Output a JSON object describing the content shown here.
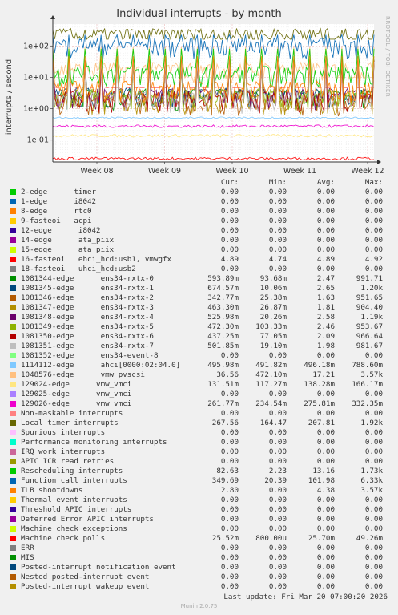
{
  "chart_data": {
    "type": "line",
    "title": "Individual interrupts - by month",
    "ylabel": "interrupts / second",
    "yscale": "log",
    "ylim": [
      0.02,
      500
    ],
    "y_ticks": [
      "1e-01",
      "1e+00",
      "1e+01",
      "1e+02"
    ],
    "x_ticks": [
      "Week 08",
      "Week 09",
      "Week 10",
      "Week 11",
      "Week 12"
    ],
    "grid": true,
    "legend_columns": [
      "Cur:",
      "Min:",
      "Avg:",
      "Max:"
    ],
    "series": [
      {
        "name": "2-edge      timer",
        "color": "#00cc00",
        "stats": [
          "0.00",
          "0.00",
          "0.00",
          "0.00"
        ]
      },
      {
        "name": "1-edge      i8042",
        "color": "#0066b3",
        "stats": [
          "0.00",
          "0.00",
          "0.00",
          "0.00"
        ]
      },
      {
        "name": "8-edge      rtc0",
        "color": "#ff8000",
        "stats": [
          "0.00",
          "0.00",
          "0.00",
          "0.00"
        ]
      },
      {
        "name": "9-fasteoi   acpi",
        "color": "#ffcc00",
        "stats": [
          "0.00",
          "0.00",
          "0.00",
          "0.00"
        ]
      },
      {
        "name": "12-edge      i8042",
        "color": "#330099",
        "stats": [
          "0.00",
          "0.00",
          "0.00",
          "0.00"
        ]
      },
      {
        "name": "14-edge      ata_piix",
        "color": "#990099",
        "stats": [
          "0.00",
          "0.00",
          "0.00",
          "0.00"
        ]
      },
      {
        "name": "15-edge      ata_piix",
        "color": "#ccff00",
        "stats": [
          "0.00",
          "0.00",
          "0.00",
          "0.00"
        ]
      },
      {
        "name": "16-fasteoi   ehci_hcd:usb1, vmwgfx",
        "color": "#ff0000",
        "stats": [
          "4.89",
          "4.74",
          "4.89",
          "4.92"
        ]
      },
      {
        "name": "18-fasteoi   uhci_hcd:usb2",
        "color": "#808080",
        "stats": [
          "0.00",
          "0.00",
          "0.00",
          "0.00"
        ]
      },
      {
        "name": "1081344-edge      ens34-rxtx-0",
        "color": "#008f00",
        "stats": [
          "593.89m",
          "93.68m",
          "2.47",
          "991.71"
        ]
      },
      {
        "name": "1081345-edge      ens34-rxtx-1",
        "color": "#00487d",
        "stats": [
          "674.57m",
          "10.06m",
          "2.65",
          "1.20k"
        ]
      },
      {
        "name": "1081346-edge      ens34-rxtx-2",
        "color": "#b35a00",
        "stats": [
          "342.77m",
          "25.38m",
          "1.63",
          "951.65"
        ]
      },
      {
        "name": "1081347-edge      ens34-rxtx-3",
        "color": "#b38f00",
        "stats": [
          "463.30m",
          "26.87m",
          "1.81",
          "904.40"
        ]
      },
      {
        "name": "1081348-edge      ens34-rxtx-4",
        "color": "#6b006b",
        "stats": [
          "525.98m",
          "20.26m",
          "2.58",
          "1.19k"
        ]
      },
      {
        "name": "1081349-edge      ens34-rxtx-5",
        "color": "#8fb300",
        "stats": [
          "472.30m",
          "103.33m",
          "2.46",
          "953.67"
        ]
      },
      {
        "name": "1081350-edge      ens34-rxtx-6",
        "color": "#b30000",
        "stats": [
          "437.25m",
          "77.05m",
          "2.09",
          "966.64"
        ]
      },
      {
        "name": "1081351-edge      ens34-rxtx-7",
        "color": "#bebebe",
        "stats": [
          "501.85m",
          "19.10m",
          "1.98",
          "981.67"
        ]
      },
      {
        "name": "1081352-edge      ens34-event-8",
        "color": "#80ff80",
        "stats": [
          "0.00",
          "0.00",
          "0.00",
          "0.00"
        ]
      },
      {
        "name": "1114112-edge      ahci[0000:02:04.0]",
        "color": "#80c9ff",
        "stats": [
          "495.98m",
          "491.82m",
          "496.18m",
          "788.60m"
        ]
      },
      {
        "name": "1048576-edge      vmw_pvscsi",
        "color": "#ffc080",
        "stats": [
          "36.56",
          "472.10m",
          "17.21",
          "3.57k"
        ]
      },
      {
        "name": "129024-edge      vmw_vmci",
        "color": "#ffe680",
        "stats": [
          "131.51m",
          "117.27m",
          "138.28m",
          "166.17m"
        ]
      },
      {
        "name": "129025-edge      vmw_vmci",
        "color": "#aa80ff",
        "stats": [
          "0.00",
          "0.00",
          "0.00",
          "0.00"
        ]
      },
      {
        "name": "129026-edge      vmw_vmci",
        "color": "#ee00cc",
        "stats": [
          "261.77m",
          "234.54m",
          "275.81m",
          "332.35m"
        ]
      },
      {
        "name": "Non-maskable interrupts",
        "color": "#ff8080",
        "stats": [
          "0.00",
          "0.00",
          "0.00",
          "0.00"
        ]
      },
      {
        "name": "Local timer interrupts",
        "color": "#666600",
        "stats": [
          "267.56",
          "164.47",
          "207.81",
          "1.92k"
        ]
      },
      {
        "name": "Spurious interrupts",
        "color": "#ffbfff",
        "stats": [
          "0.00",
          "0.00",
          "0.00",
          "0.00"
        ]
      },
      {
        "name": "Performance monitoring interrupts",
        "color": "#00ffcc",
        "stats": [
          "0.00",
          "0.00",
          "0.00",
          "0.00"
        ]
      },
      {
        "name": "IRQ work interrupts",
        "color": "#cc6699",
        "stats": [
          "0.00",
          "0.00",
          "0.00",
          "0.00"
        ]
      },
      {
        "name": "APIC ICR read retries",
        "color": "#999900",
        "stats": [
          "0.00",
          "0.00",
          "0.00",
          "0.00"
        ]
      },
      {
        "name": "Rescheduling interrupts",
        "color": "#00cc00",
        "stats": [
          "82.63",
          "2.23",
          "13.16",
          "1.73k"
        ]
      },
      {
        "name": "Function call interrupts",
        "color": "#0066b3",
        "stats": [
          "349.69",
          "20.39",
          "101.98",
          "6.33k"
        ]
      },
      {
        "name": "TLB shootdowns",
        "color": "#ff8000",
        "stats": [
          "2.80",
          "0.00",
          "4.38",
          "3.57k"
        ]
      },
      {
        "name": "Thermal event interrupts",
        "color": "#ffcc00",
        "stats": [
          "0.00",
          "0.00",
          "0.00",
          "0.00"
        ]
      },
      {
        "name": "Threshold APIC interrupts",
        "color": "#330099",
        "stats": [
          "0.00",
          "0.00",
          "0.00",
          "0.00"
        ]
      },
      {
        "name": "Deferred Error APIC interrupts",
        "color": "#990099",
        "stats": [
          "0.00",
          "0.00",
          "0.00",
          "0.00"
        ]
      },
      {
        "name": "Machine check exceptions",
        "color": "#ccff00",
        "stats": [
          "0.00",
          "0.00",
          "0.00",
          "0.00"
        ]
      },
      {
        "name": "Machine check polls",
        "color": "#ff0000",
        "stats": [
          "25.52m",
          "800.00u",
          "25.70m",
          "49.26m"
        ]
      },
      {
        "name": "ERR",
        "color": "#808080",
        "stats": [
          "0.00",
          "0.00",
          "0.00",
          "0.00"
        ]
      },
      {
        "name": "MIS",
        "color": "#008f00",
        "stats": [
          "0.00",
          "0.00",
          "0.00",
          "0.00"
        ]
      },
      {
        "name": "Posted-interrupt notification event",
        "color": "#00487d",
        "stats": [
          "0.00",
          "0.00",
          "0.00",
          "0.00"
        ]
      },
      {
        "name": "Nested posted-interrupt event",
        "color": "#b35a00",
        "stats": [
          "0.00",
          "0.00",
          "0.00",
          "0.00"
        ]
      },
      {
        "name": "Posted-interrupt wakeup event",
        "color": "#b38f00",
        "stats": [
          "0.00",
          "0.00",
          "0.00",
          "0.00"
        ]
      }
    ]
  },
  "footer": {
    "last_update": "Last update: Fri Mar 20 07:00:20 2026",
    "credit": "Munin 2.0.75",
    "side_watermark": "RRDTOOL / TOBI OETIKER"
  }
}
